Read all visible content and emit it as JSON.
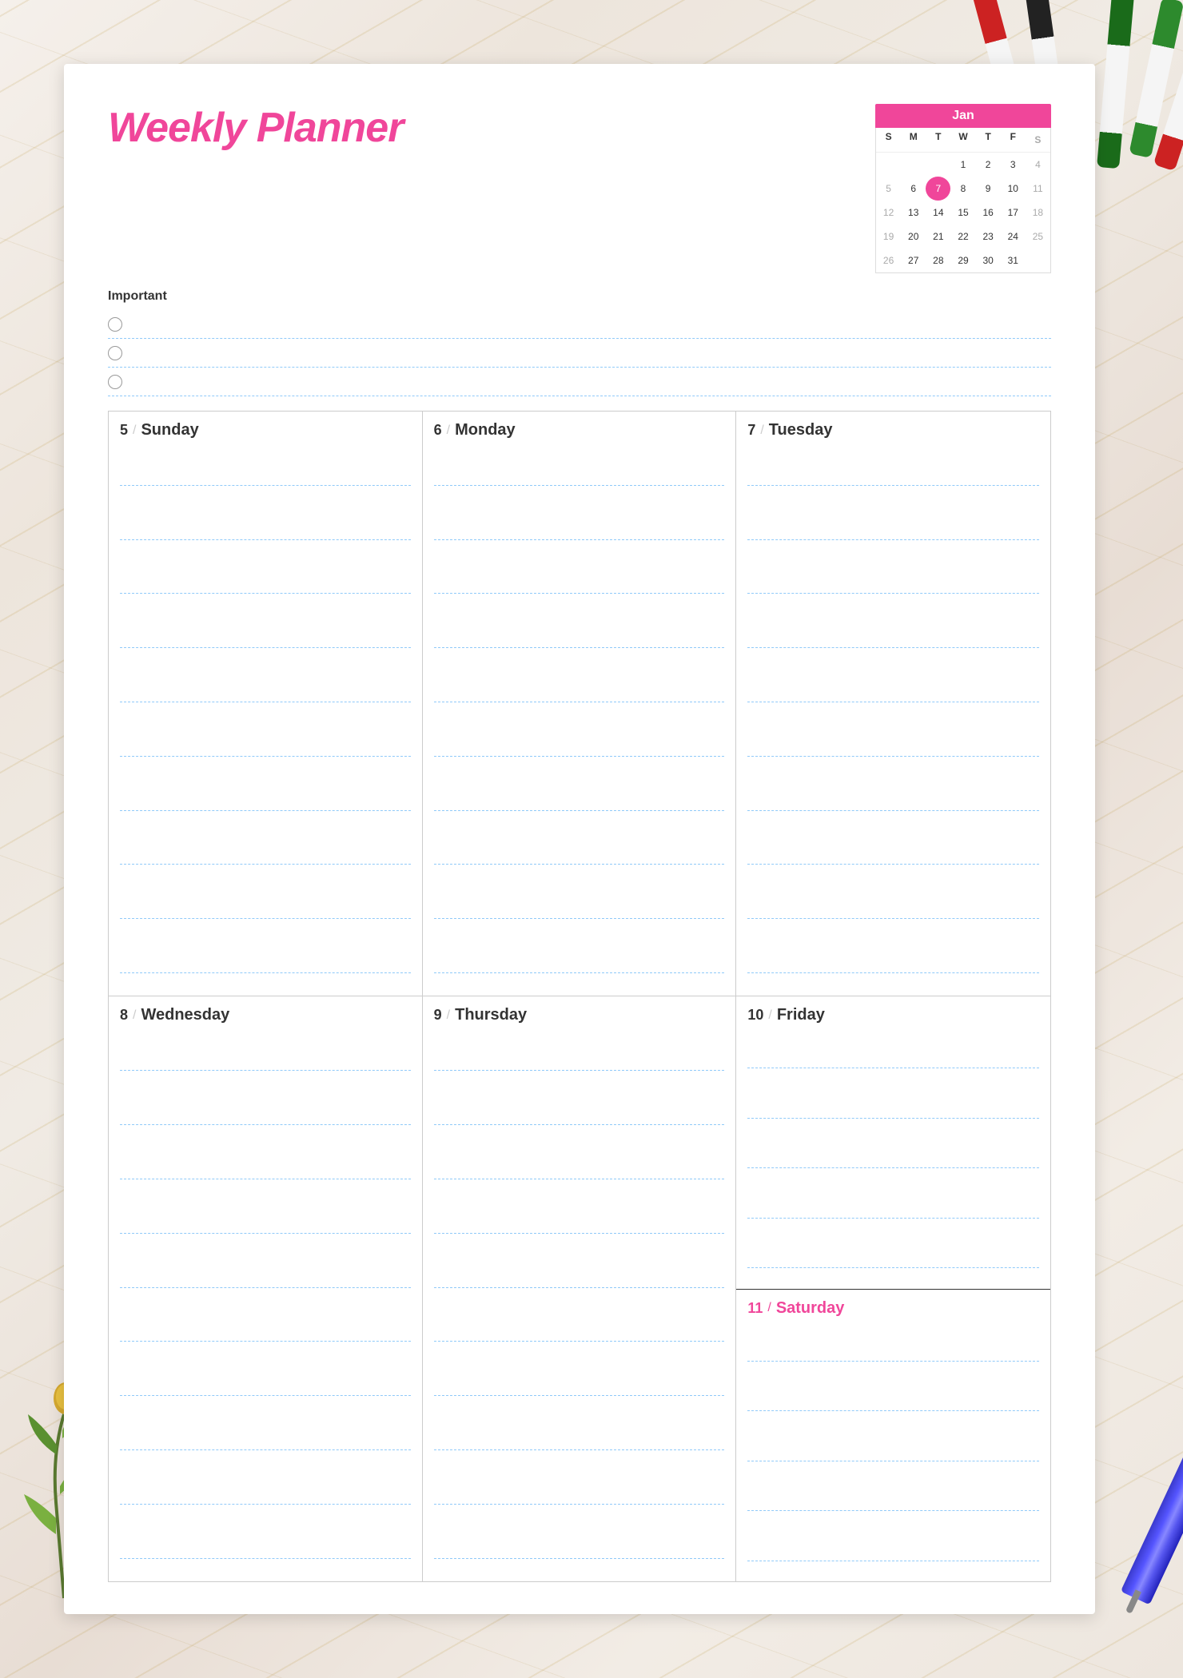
{
  "background": {
    "description": "marble texture background"
  },
  "planner": {
    "title": "Weekly Planner",
    "important_label": "Important",
    "important_rows": 3,
    "calendar": {
      "month": "Jan",
      "day_headers": [
        "S",
        "M",
        "T",
        "W",
        "T",
        "F",
        "S"
      ],
      "weeks": [
        [
          "",
          "",
          "",
          "1",
          "2",
          "3",
          "4"
        ],
        [
          "5",
          "6",
          "7",
          "8",
          "9",
          "10",
          "11"
        ],
        [
          "12",
          "13",
          "14",
          "15",
          "16",
          "17",
          "18"
        ],
        [
          "19",
          "20",
          "21",
          "22",
          "23",
          "24",
          "25"
        ],
        [
          "26",
          "27",
          "28",
          "29",
          "30",
          "31",
          ""
        ]
      ],
      "highlight_day": "7"
    },
    "days": [
      {
        "number": "5",
        "name": "Sunday",
        "saturday": false
      },
      {
        "number": "6",
        "name": "Monday",
        "saturday": false
      },
      {
        "number": "7",
        "name": "Tuesday",
        "saturday": false
      },
      {
        "number": "8",
        "name": "Wednesday",
        "saturday": false
      },
      {
        "number": "9",
        "name": "Thursday",
        "saturday": false
      },
      {
        "number": "10",
        "name": "Friday",
        "saturday": false
      },
      {
        "number": "11",
        "name": "Saturday",
        "saturday": true
      }
    ]
  }
}
